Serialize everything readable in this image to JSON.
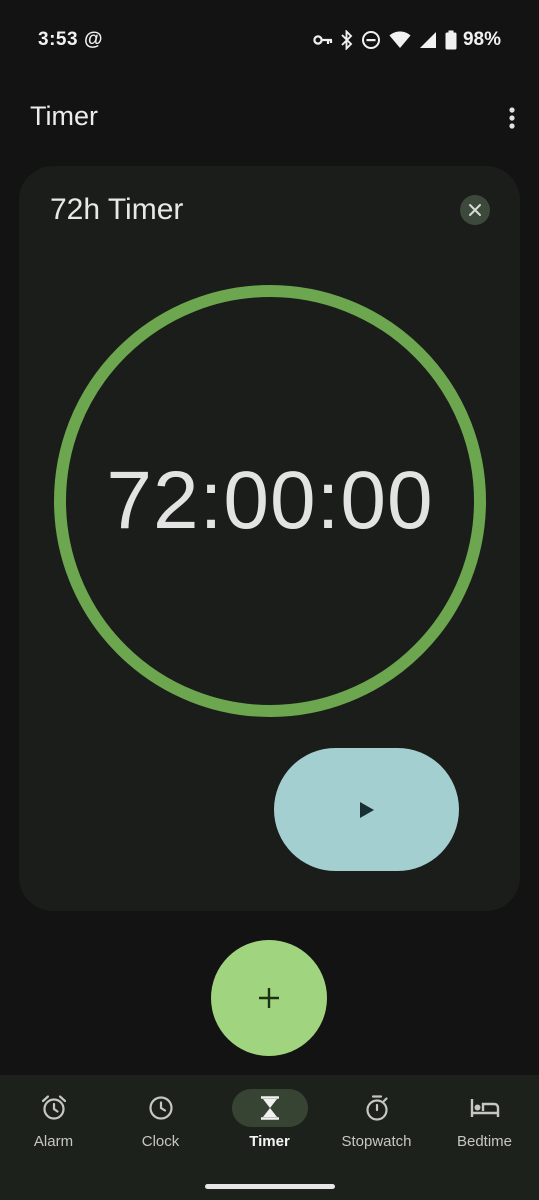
{
  "status_bar": {
    "time": "3:53",
    "notification_symbol": "@",
    "battery_percent": "98%",
    "icons": [
      "key-icon",
      "bluetooth-icon",
      "do-not-disturb-icon",
      "wifi-icon",
      "cellular-icon",
      "battery-icon"
    ]
  },
  "app_bar": {
    "title": "Timer",
    "overflow_icon": "more-vert-icon"
  },
  "timer_card": {
    "label": "72h Timer",
    "remaining": "72:00:00",
    "progress": 1.0,
    "ring_color": "#6ca64f",
    "close_icon": "close-icon",
    "play_icon": "play-icon",
    "play_button_color": "#a4cfd1"
  },
  "fab": {
    "icon": "plus-icon",
    "color": "#a1d47f"
  },
  "bottom_nav": {
    "active": "Timer",
    "items": [
      {
        "label": "Alarm",
        "icon": "alarm-icon"
      },
      {
        "label": "Clock",
        "icon": "clock-icon"
      },
      {
        "label": "Timer",
        "icon": "hourglass-icon"
      },
      {
        "label": "Stopwatch",
        "icon": "stopwatch-icon"
      },
      {
        "label": "Bedtime",
        "icon": "bed-icon"
      }
    ]
  }
}
